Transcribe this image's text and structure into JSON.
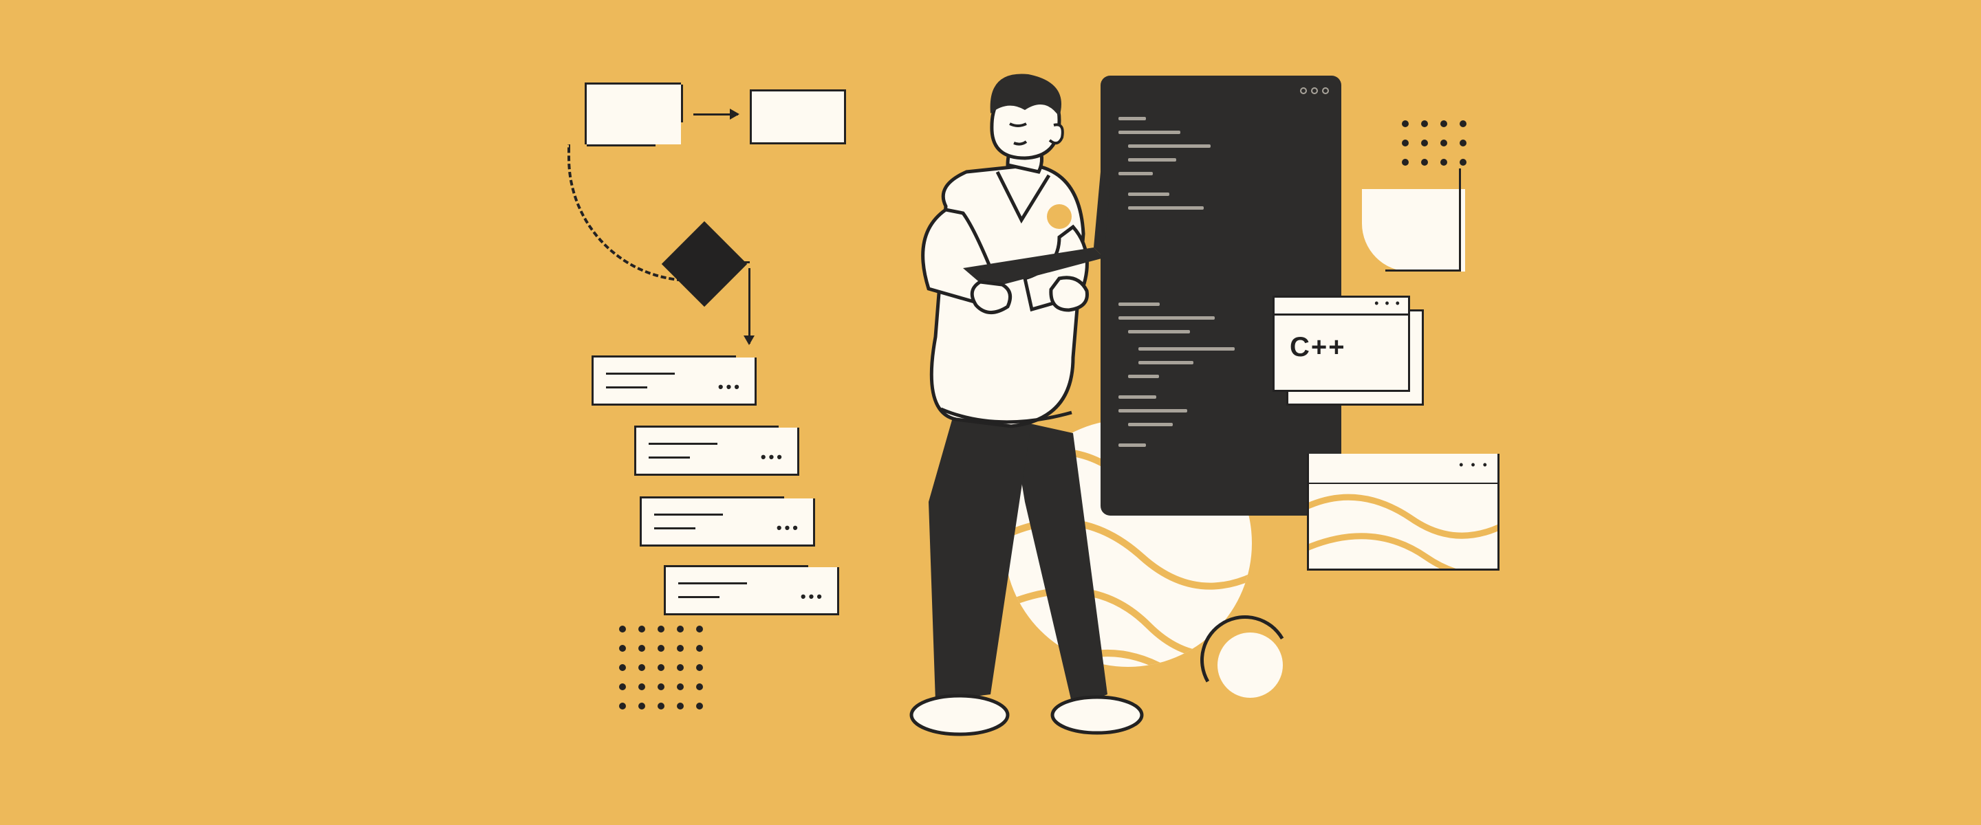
{
  "illustration": {
    "theme": "software-developer-flat-illustration",
    "palette": {
      "background": "#edb95a",
      "ink": "#232222",
      "paper": "#fefaf2",
      "codeWindow": "#2d2c2b",
      "codeLine": "#a8a39a"
    },
    "code_window_label": "C++"
  }
}
